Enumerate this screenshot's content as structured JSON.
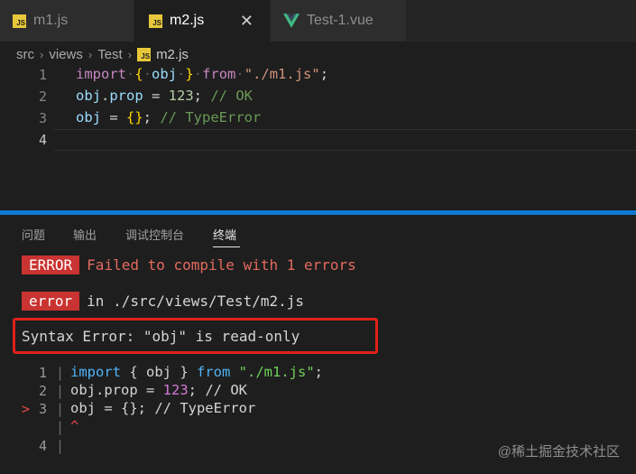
{
  "tabs": [
    {
      "label": "m1.js",
      "icon": "js-icon"
    },
    {
      "label": "m2.js",
      "icon": "js-icon",
      "close": "✕"
    },
    {
      "label": "Test-1.vue",
      "icon": "vue-icon"
    }
  ],
  "breadcrumb": [
    "src",
    "views",
    "Test",
    "m2.js"
  ],
  "editor": {
    "line_numbers": [
      "1",
      "2",
      "3",
      "4"
    ],
    "line1": {
      "kw": "import",
      "open": "{",
      "var": "obj",
      "close": "}",
      "kw2": "from",
      "str": "\"./m1.js\"",
      "end": ";"
    },
    "line2": {
      "a": "obj",
      "dot": ".",
      "b": "prop",
      "eq": " = ",
      "num": "123",
      "end": "; ",
      "cmt": "// OK"
    },
    "line3": {
      "a": "obj",
      "eq": " = ",
      "braces": "{}",
      "end": "; ",
      "cmt": "// TypeError"
    }
  },
  "panel": {
    "tabs": [
      "问题",
      "输出",
      "调试控制台",
      "终端"
    ],
    "error_badge": "ERROR",
    "error_msg": "Failed to compile with 1 errors",
    "error_badge2": "error",
    "error_path": "in ./src/views/Test/m2.js",
    "syntax_error": "Syntax Error: \"obj\" is read-only",
    "frame": {
      "line_numbers": [
        "1",
        "2",
        "3",
        "",
        "4"
      ],
      "marker": ">",
      "line1": {
        "kw": "import",
        "mid": " { obj } ",
        "kw2": "from",
        "sp": " ",
        "str": "\"./m1.js\"",
        "end": ";"
      },
      "line2": {
        "a": "obj.prop = ",
        "num": "123",
        "end": "; // OK"
      },
      "line3": "obj = {}; // TypeError",
      "caret": "^"
    }
  },
  "watermark": "@稀土掘金技术社区"
}
